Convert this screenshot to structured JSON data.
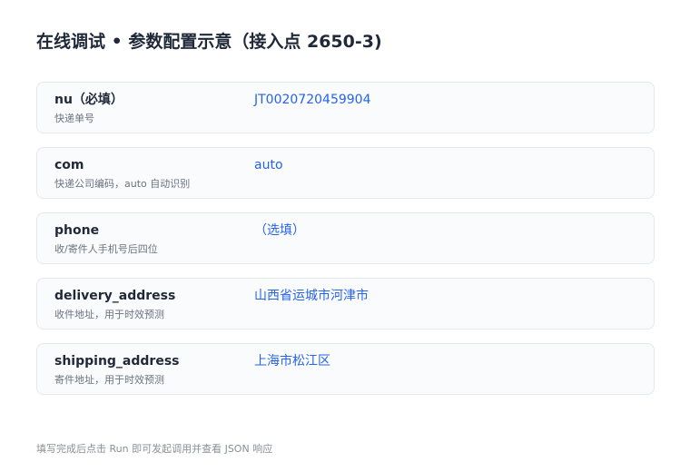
{
  "page": {
    "title": "在线调试 • 参数配置示意（接入点 2650-3)"
  },
  "params": [
    {
      "key": "nu（必填）",
      "desc": "快递单号",
      "value": "JT0020720459904"
    },
    {
      "key": "com",
      "desc": "快递公司编码，auto 自动识别",
      "value": "auto"
    },
    {
      "key": "phone",
      "desc": "收/寄件人手机号后四位",
      "value": "（选填）"
    },
    {
      "key": "delivery_address",
      "desc": "收件地址，用于时效预测",
      "value": "山西省运城市河津市"
    },
    {
      "key": "shipping_address",
      "desc": "寄件地址，用于时效预测",
      "value": "上海市松江区"
    }
  ],
  "footer": {
    "hint": "填写完成后点击 Run 即可发起调用并查看 JSON 响应"
  },
  "colors": {
    "value_text": "#2563eb",
    "row_border": "#e5e7eb",
    "row_background": "#fafbfc"
  }
}
